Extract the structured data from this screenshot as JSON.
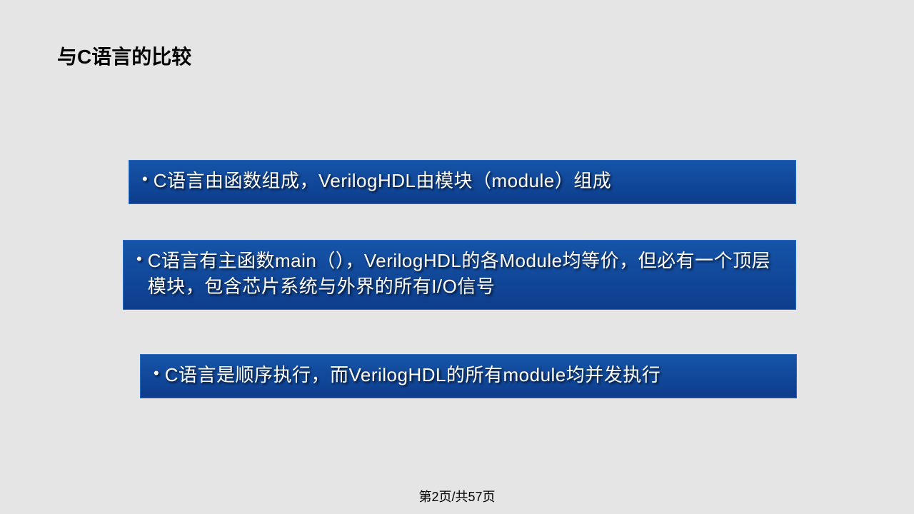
{
  "slide": {
    "title": "与C语言的比较",
    "bullets": [
      " C语言由函数组成，VerilogHDL由模块（module）组成",
      "C语言有主函数main（），VerilogHDL的各Module均等价，但必有一个顶层模块，包含芯片系统与外界的所有I/O信号",
      "C语言是顺序执行，而VerilogHDL的所有module均并发执行"
    ],
    "page_indicator": "第2页/共57页"
  }
}
